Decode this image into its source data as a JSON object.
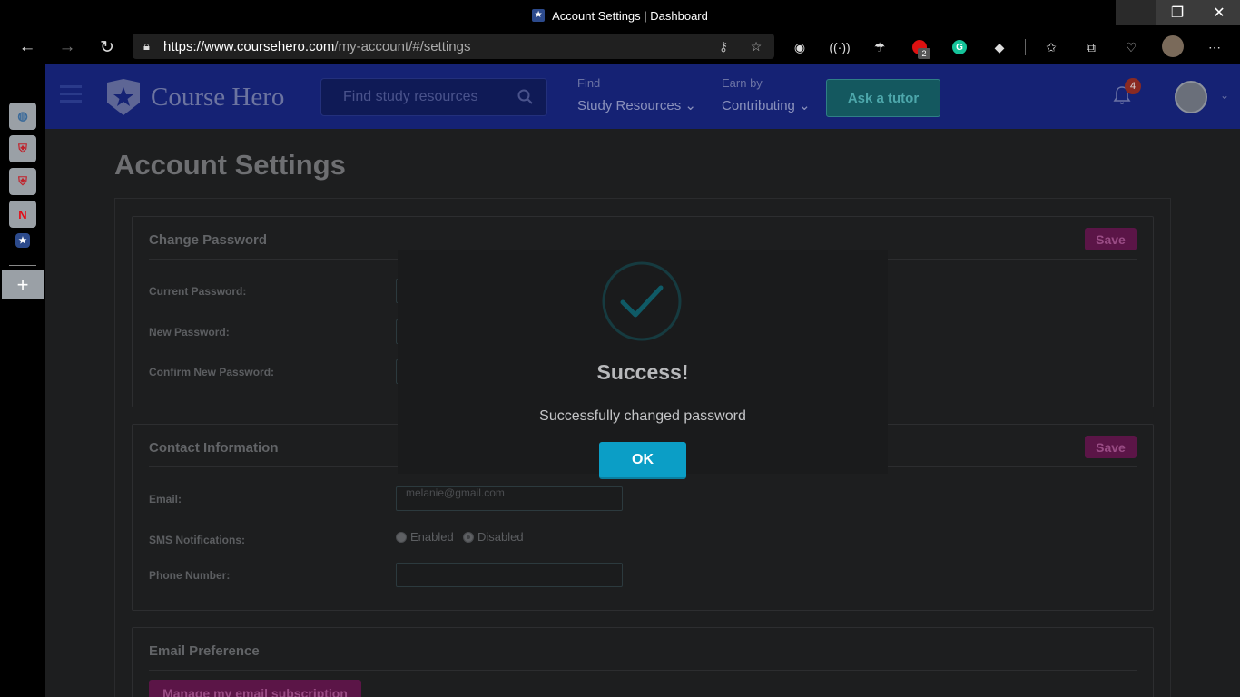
{
  "browser": {
    "window_title": "Account Settings | Dashboard",
    "url_host": "https://www.coursehero.com",
    "url_path": "/my-account/#/settings",
    "extension_badge": "2",
    "buttons": {
      "back": "←",
      "forward": "→",
      "refresh": "↻",
      "minimize": "—",
      "restore": "❐",
      "close": "✕"
    }
  },
  "vertical_tabs": {
    "items": [
      {
        "icon": "vtab-globe-icon",
        "glyph": "◍"
      },
      {
        "icon": "vtab-shield-icon",
        "glyph": "⛨"
      },
      {
        "icon": "vtab-shield-icon",
        "glyph": "⛨"
      },
      {
        "icon": "vtab-netflix-icon",
        "glyph": "N"
      },
      {
        "icon": "vtab-coursehero-icon",
        "glyph": "★"
      }
    ],
    "add": "+"
  },
  "site_header": {
    "logo_text": "Course Hero",
    "search_placeholder": "Find study resources",
    "nav": [
      {
        "small": "Find",
        "label": "Study Resources ⌄"
      },
      {
        "small": "Earn by",
        "label": "Contributing ⌄"
      }
    ],
    "ask_tutor": "Ask a tutor",
    "notification_count": "4"
  },
  "page": {
    "title": "Account Settings",
    "change_password": {
      "title": "Change Password",
      "save": "Save",
      "current_label": "Current Password:",
      "new_label": "New Password:",
      "confirm_label": "Confirm New Password:"
    },
    "contact_info": {
      "title": "Contact Information",
      "save": "Save",
      "email_label": "Email:",
      "email_value": "melanie@gmail.com",
      "sms_label": "SMS Notifications:",
      "sms_enabled": "Enabled",
      "sms_disabled": "Disabled",
      "phone_label": "Phone Number:"
    },
    "email_pref": {
      "title": "Email Preference",
      "manage": "Manage my email subscription"
    }
  },
  "modal": {
    "title": "Success!",
    "message": "Successfully changed password",
    "ok": "OK"
  },
  "colors": {
    "header_bg": "#152274",
    "ok_button": "#0b9ec6",
    "save_button": "#5b1547",
    "check_color": "#0f5a66"
  }
}
